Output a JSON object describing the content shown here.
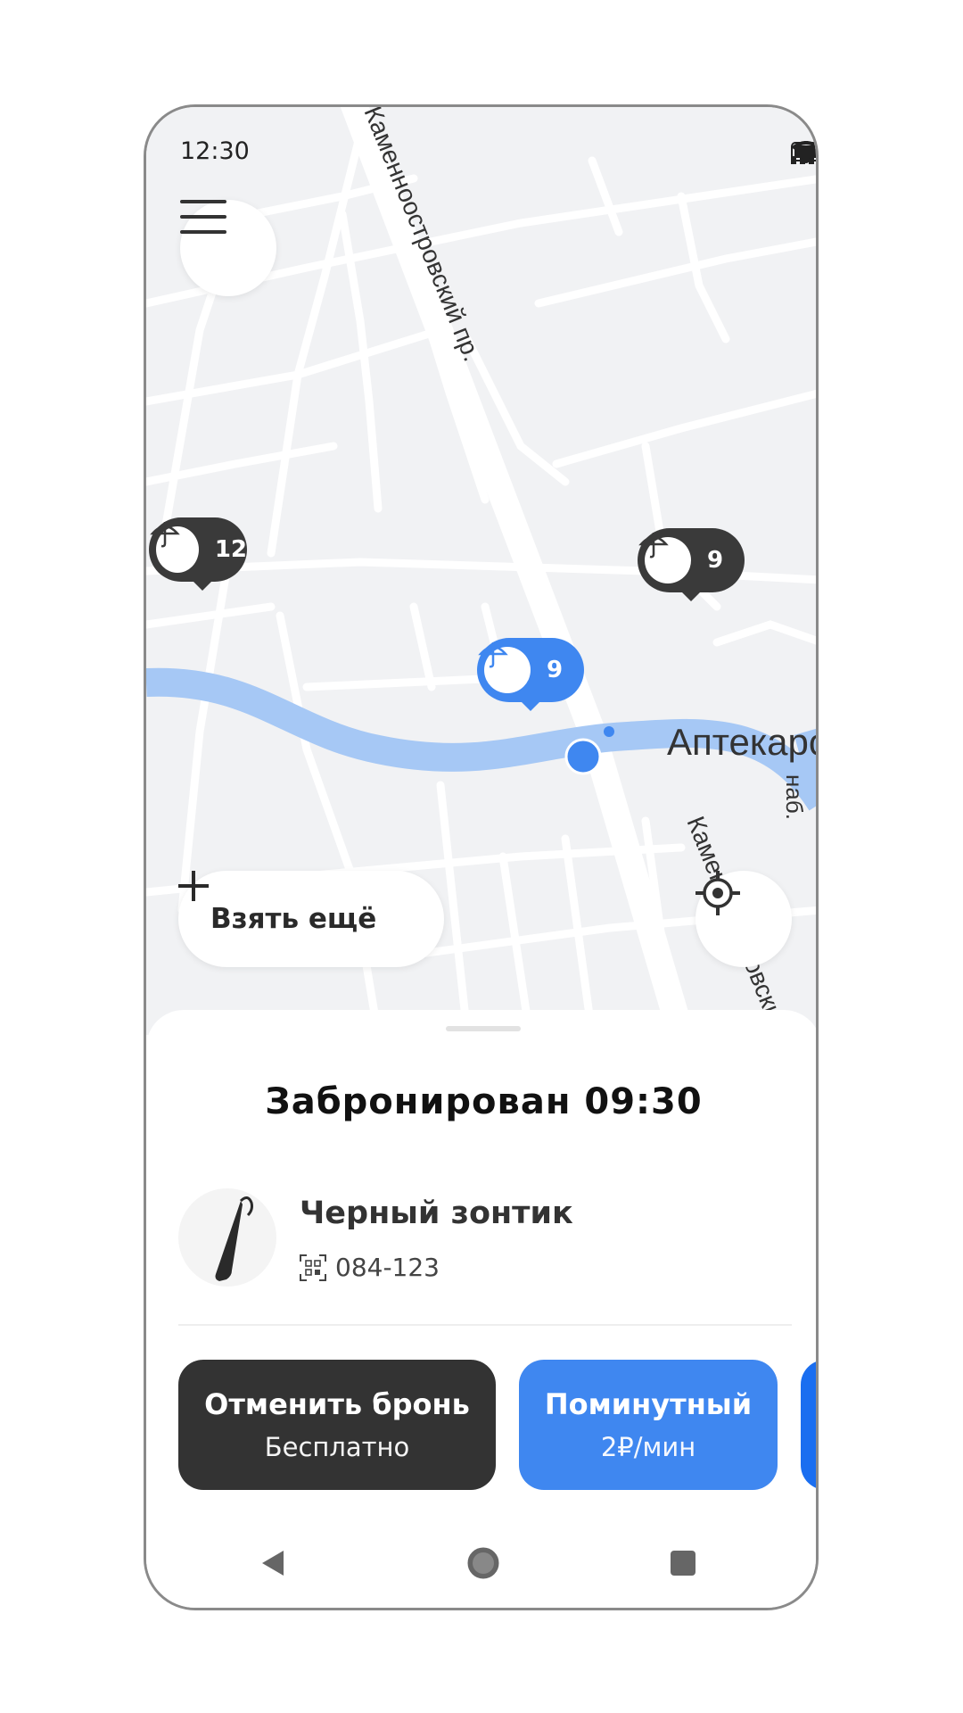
{
  "status_bar": {
    "time": "12:30"
  },
  "map": {
    "street_labels": [
      "Каменноостровский пр.",
      "Аптекарский",
      "наб.",
      "Каменноостровский пр."
    ],
    "pins": [
      {
        "count": "12",
        "style": "dark"
      },
      {
        "count": "9",
        "style": "dark"
      },
      {
        "count": "9",
        "style": "blue"
      }
    ],
    "take_more_label": "Взять ещё"
  },
  "sheet": {
    "title": "Забронирован 09:30",
    "item_name": "Черный зонтик",
    "item_code": "084-123",
    "cancel": {
      "title": "Отменить бронь",
      "subtitle": "Бесплатно"
    },
    "per_minute": {
      "title": "Поминутный",
      "subtitle": "2₽/мин"
    }
  },
  "colors": {
    "accent": "#3f87f0",
    "dark": "#333333",
    "river": "#a6c8f5"
  },
  "icons": [
    "menu-icon",
    "locate-icon",
    "plus-icon",
    "umbrella-icon",
    "qr-icon",
    "signal-icon",
    "wifi-icon",
    "battery-icon",
    "back-icon",
    "home-icon",
    "recents-icon"
  ]
}
